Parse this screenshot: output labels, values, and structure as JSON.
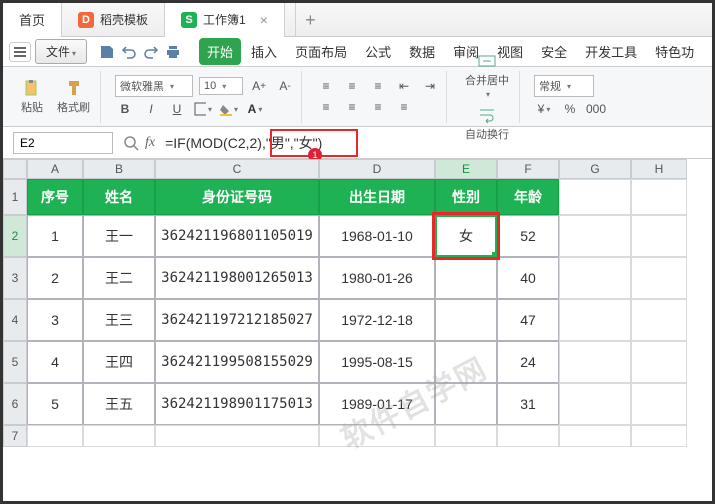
{
  "tabs": {
    "home": "首页",
    "template": "稻壳模板",
    "workbook": "工作簿1"
  },
  "filemenu": "文件",
  "menu": {
    "start": "开始",
    "insert": "插入",
    "layout": "页面布局",
    "formula": "公式",
    "data": "数据",
    "review": "审阅",
    "view": "视图",
    "security": "安全",
    "dev": "开发工具",
    "special": "特色功"
  },
  "ribbon": {
    "paste": "粘贴",
    "format_painter": "格式刷",
    "font": "微软雅黑",
    "size": "10",
    "merge": "合并居中",
    "wrap": "自动换行",
    "numfmt": "常规"
  },
  "namebox": "E2",
  "formula_prefix": "=IF",
  "formula_mod": "(MOD(C2,2)",
  "formula_suffix": ",\"男\",\"女\")",
  "badge": "1",
  "cols": [
    "A",
    "B",
    "C",
    "D",
    "E",
    "F",
    "G",
    "H"
  ],
  "rows": [
    "1",
    "2",
    "3",
    "4",
    "5",
    "6",
    "7"
  ],
  "headers": {
    "a": "序号",
    "b": "姓名",
    "c": "身份证号码",
    "d": "出生日期",
    "e": "性别",
    "f": "年龄"
  },
  "data": [
    {
      "a": "1",
      "b": "王一",
      "c": "362421196801105019",
      "d": "1968-01-10",
      "e": "女",
      "f": "52"
    },
    {
      "a": "2",
      "b": "王二",
      "c": "362421198001265013",
      "d": "1980-01-26",
      "e": "",
      "f": "40"
    },
    {
      "a": "3",
      "b": "王三",
      "c": "362421197212185027",
      "d": "1972-12-18",
      "e": "",
      "f": "47"
    },
    {
      "a": "4",
      "b": "王四",
      "c": "362421199508155029",
      "d": "1995-08-15",
      "e": "",
      "f": "24"
    },
    {
      "a": "5",
      "b": "王五",
      "c": "362421198901175013",
      "d": "1989-01-17",
      "e": "",
      "f": "31"
    }
  ],
  "watermark": "软件自学网"
}
